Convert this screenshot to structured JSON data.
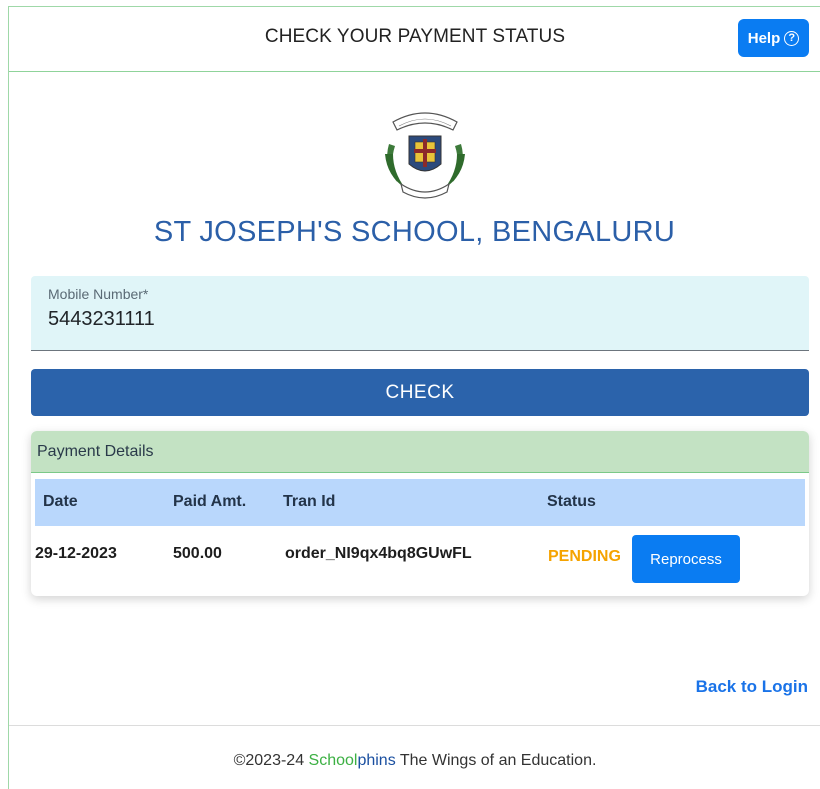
{
  "header": {
    "title": "CHECK YOUR PAYMENT STATUS",
    "help_label": "Help",
    "help_icon": "question-circle-icon"
  },
  "school": {
    "name": "ST JOSEPH'S SCHOOL, BENGALURU",
    "logo_icon": "school-crest-icon"
  },
  "form": {
    "mobile_label": "Mobile Number*",
    "mobile_value": "5443231111",
    "check_label": "CHECK"
  },
  "payments": {
    "title": "Payment Details",
    "columns": [
      "Date",
      "Paid Amt.",
      "Tran Id",
      "Status"
    ],
    "rows": [
      {
        "date": "29-12-2023",
        "amount": "500.00",
        "tran_id": "order_NI9qx4bq8GUwFL",
        "status": "PENDING",
        "action": "Reprocess"
      }
    ]
  },
  "nav": {
    "back_label": "Back to Login"
  },
  "footer": {
    "prefix": "©2023-24 ",
    "brand_part1": "School",
    "brand_part2": "phins",
    "suffix": " The Wings of an Education."
  },
  "colors": {
    "accent": "#0a7cf2",
    "primary": "#2b63ab",
    "pending": "#f5a300",
    "brand_green": "#3cb043"
  }
}
